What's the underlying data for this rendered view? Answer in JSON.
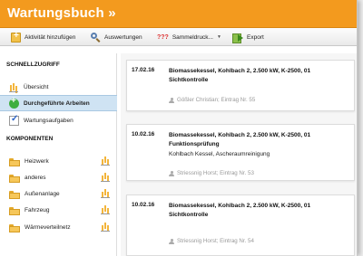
{
  "app": {
    "title": "Wartungsbuch »"
  },
  "toolbar": {
    "add_activity": "Aktivität hinzufügen",
    "evaluations": "Auswertungen",
    "bulk_print_prefix": "???",
    "bulk_print": "Sammeldruck...",
    "export": "Export"
  },
  "sidebar": {
    "quick_access_heading": "SCHNELLZUGRIFF",
    "quick_items": [
      {
        "label": "Übersicht",
        "icon": "bar-chart-icon"
      },
      {
        "label": "Durchgeführte Arbeiten",
        "icon": "add-circle-icon",
        "active": true
      },
      {
        "label": "Wartungsaufgaben",
        "icon": "checkbox-icon"
      }
    ],
    "components_heading": "KOMPONENTEN",
    "components": [
      {
        "label": "Heizwerk"
      },
      {
        "label": "anderes"
      },
      {
        "label": "Außenanlage"
      },
      {
        "label": "Fahrzeug"
      },
      {
        "label": "Wärmeverteilnetz"
      }
    ]
  },
  "entries": [
    {
      "date": "17.02.16",
      "title": "Biomassekessel, Kohlbach 2, 2.500 kW, K-2500, 01 Sichtkontrolle",
      "subtitle": "",
      "meta": "Gößler Christian; Eintrag Nr. 55"
    },
    {
      "date": "10.02.16",
      "title": "Biomassekessel, Kohlbach 2, 2.500 kW, K-2500, 01 Funktionsprüfung",
      "subtitle": "Kohlbach Kessel, Ascheraumreinigung",
      "meta": "Striessnig Horst; Eintrag Nr. 53"
    },
    {
      "date": "10.02.16",
      "title": "Biomassekessel, Kohlbach 2, 2.500 kW, K-2500, 01 Sichtkontrolle",
      "subtitle": "",
      "meta": "Striessnig Horst; Eintrag Nr. 54"
    }
  ],
  "colors": {
    "brand": "#f39a1e",
    "active_nav": "#cfe3f3"
  }
}
